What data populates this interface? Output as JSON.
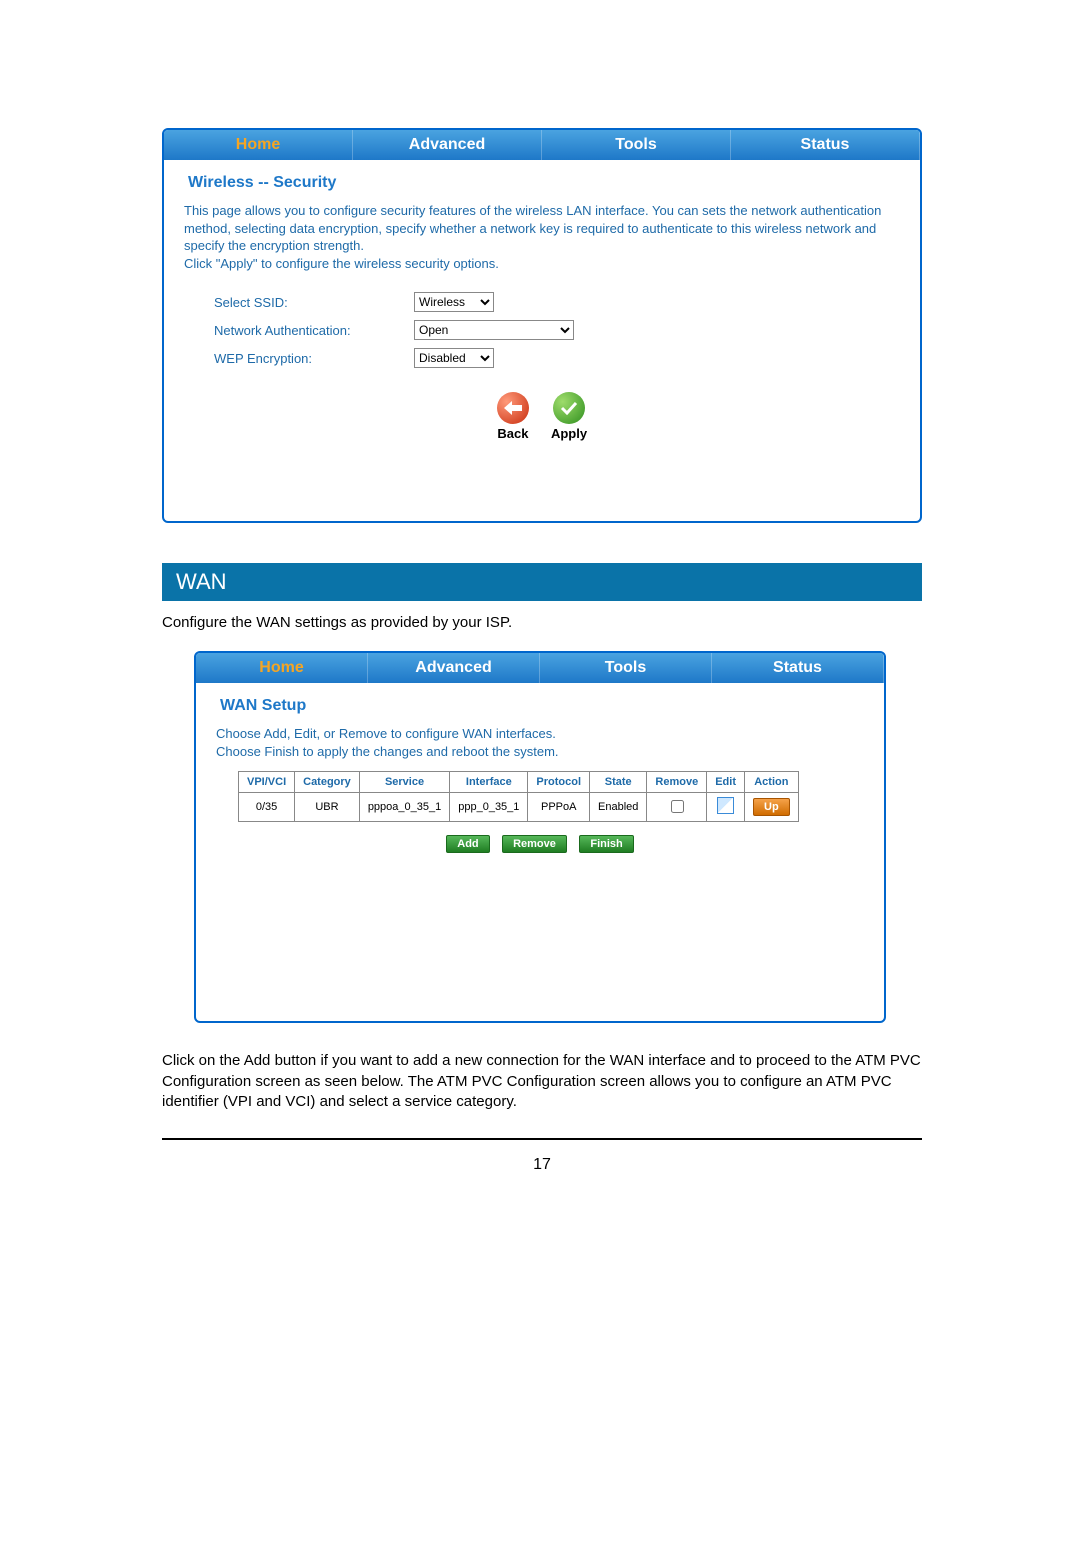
{
  "tabs": [
    "Home",
    "Advanced",
    "Tools",
    "Status"
  ],
  "wireless": {
    "title": "Wireless -- Security",
    "description": "This page allows you to configure security features of the wireless LAN interface. You can sets the network authentication method, selecting data encryption, specify whether a network key is required to authenticate to this wireless network and specify the encryption strength.\nClick \"Apply\" to configure the wireless security options.",
    "fields": {
      "ssid": {
        "label": "Select SSID:",
        "value": "Wireless"
      },
      "auth": {
        "label": "Network Authentication:",
        "value": "Open"
      },
      "wep": {
        "label": "WEP Encryption:",
        "value": "Disabled"
      }
    },
    "buttons": {
      "back": "Back",
      "apply": "Apply"
    }
  },
  "wan_section": {
    "heading": "WAN",
    "intro": "Configure the WAN settings as provided by your ISP."
  },
  "wan": {
    "title": "WAN Setup",
    "description": "Choose Add, Edit, or Remove to configure WAN interfaces.\nChoose Finish to apply the changes and reboot the system.",
    "columns": [
      "VPI/VCI",
      "Category",
      "Service",
      "Interface",
      "Protocol",
      "State",
      "Remove",
      "Edit",
      "Action"
    ],
    "rows": [
      {
        "vpivci": "0/35",
        "category": "UBR",
        "service": "pppoa_0_35_1",
        "interface": "ppp_0_35_1",
        "protocol": "PPPoA",
        "state": "Enabled",
        "remove": false,
        "action": "Up"
      }
    ],
    "buttons": {
      "add": "Add",
      "remove": "Remove",
      "finish": "Finish"
    }
  },
  "foot": "Click on the Add button if you want to add a new connection for the WAN interface and to proceed to the ATM PVC Configuration screen as seen below.  The ATM PVC Configuration screen allows you to configure an ATM PVC identifier (VPI and VCI) and select a service category.",
  "page_number": "17"
}
